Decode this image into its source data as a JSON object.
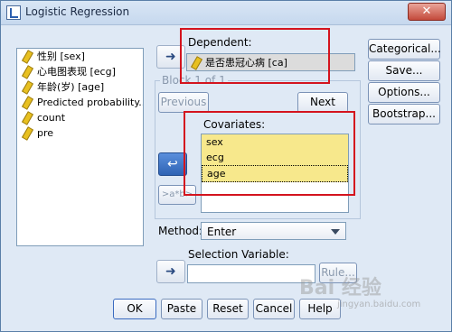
{
  "window": {
    "title": "Logistic Regression",
    "close_label": "✕"
  },
  "variables": [
    {
      "label": "性别 [sex]"
    },
    {
      "label": "心电图表现 [ecg]"
    },
    {
      "label": "年龄(岁) [age]"
    },
    {
      "label": "Predicted probability..."
    },
    {
      "label": "count"
    },
    {
      "label": "pre"
    }
  ],
  "dependent": {
    "label": "Dependent:",
    "value": "是否患冠心病 [ca]"
  },
  "block": {
    "label": "Block 1 of 1",
    "previous": "Previous",
    "next": "Next"
  },
  "covariates": {
    "label": "Covariates:",
    "items": [
      "sex",
      "ecg",
      "age"
    ]
  },
  "interaction_button": ">a*b>",
  "method": {
    "label": "Method:",
    "value": "Enter"
  },
  "selection": {
    "label": "Selection Variable:",
    "rule": "Rule..."
  },
  "side_buttons": [
    "Categorical...",
    "Save...",
    "Options...",
    "Bootstrap..."
  ],
  "bottom_buttons": [
    "OK",
    "Paste",
    "Reset",
    "Cancel",
    "Help"
  ],
  "watermark": {
    "main": "Bai 经验",
    "url": "jingyan.baidu.com"
  },
  "colors": {
    "highlight_box": "#d4141e",
    "covariate_bg": "#f7e88c",
    "dialog_bg": "#dfe9f5"
  }
}
